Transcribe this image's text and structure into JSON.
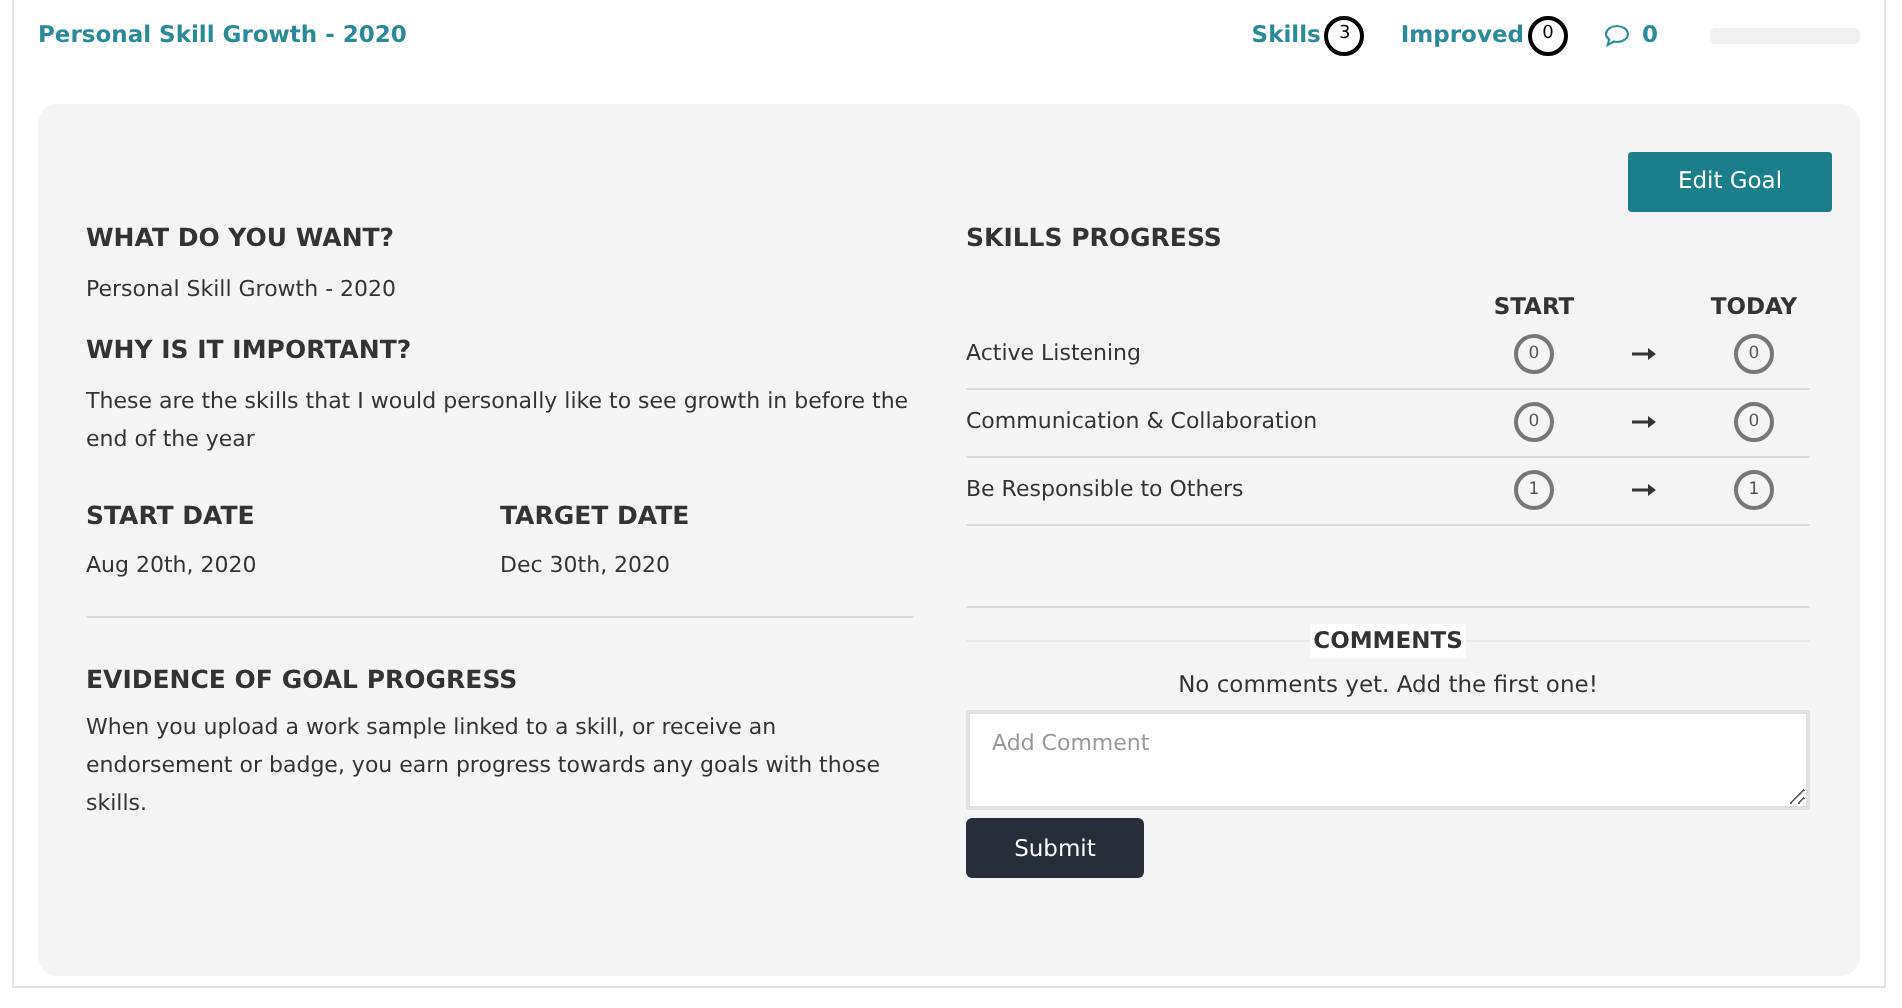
{
  "header": {
    "title": "Personal Skill Growth - 2020",
    "stats": [
      {
        "label": "Skills",
        "count": "3"
      },
      {
        "label": "Improved",
        "count": "0"
      }
    ],
    "comments_count": "0",
    "progress": {
      "level": 0
    }
  },
  "edit_button": "Edit Goal",
  "left": {
    "sections": [
      {
        "heading": "WHAT DO YOU WANT?",
        "text": "Personal Skill Growth - 2020"
      },
      {
        "heading": "WHY IS IT IMPORTANT?",
        "text": "These are the skills that I would personally like to see growth in before the end of the year"
      }
    ],
    "dates": [
      {
        "heading": "START DATE",
        "value": "Aug 20th, 2020"
      },
      {
        "heading": "TARGET DATE",
        "value": "Dec 30th, 2020"
      }
    ],
    "evidence": {
      "heading": "EVIDENCE OF GOAL PROGRESS",
      "text": "When you upload a work sample linked to a skill, or receive an endorsement or badge, you earn progress towards any goals with those skills."
    }
  },
  "skills": {
    "heading": "SKILLS PROGRESS",
    "columns": [
      "START",
      "TODAY"
    ],
    "rows": [
      {
        "name": "Active Listening",
        "start": "0",
        "today": "0"
      },
      {
        "name": "Communication & Collaboration",
        "start": "0",
        "today": "0"
      },
      {
        "name": "Be Responsible to Others",
        "start": "1",
        "today": "1"
      }
    ]
  },
  "comments": {
    "heading": "COMMENTS",
    "empty_text": "No comments yet. Add the first one!",
    "placeholder": "Add Comment",
    "submit": "Submit"
  }
}
